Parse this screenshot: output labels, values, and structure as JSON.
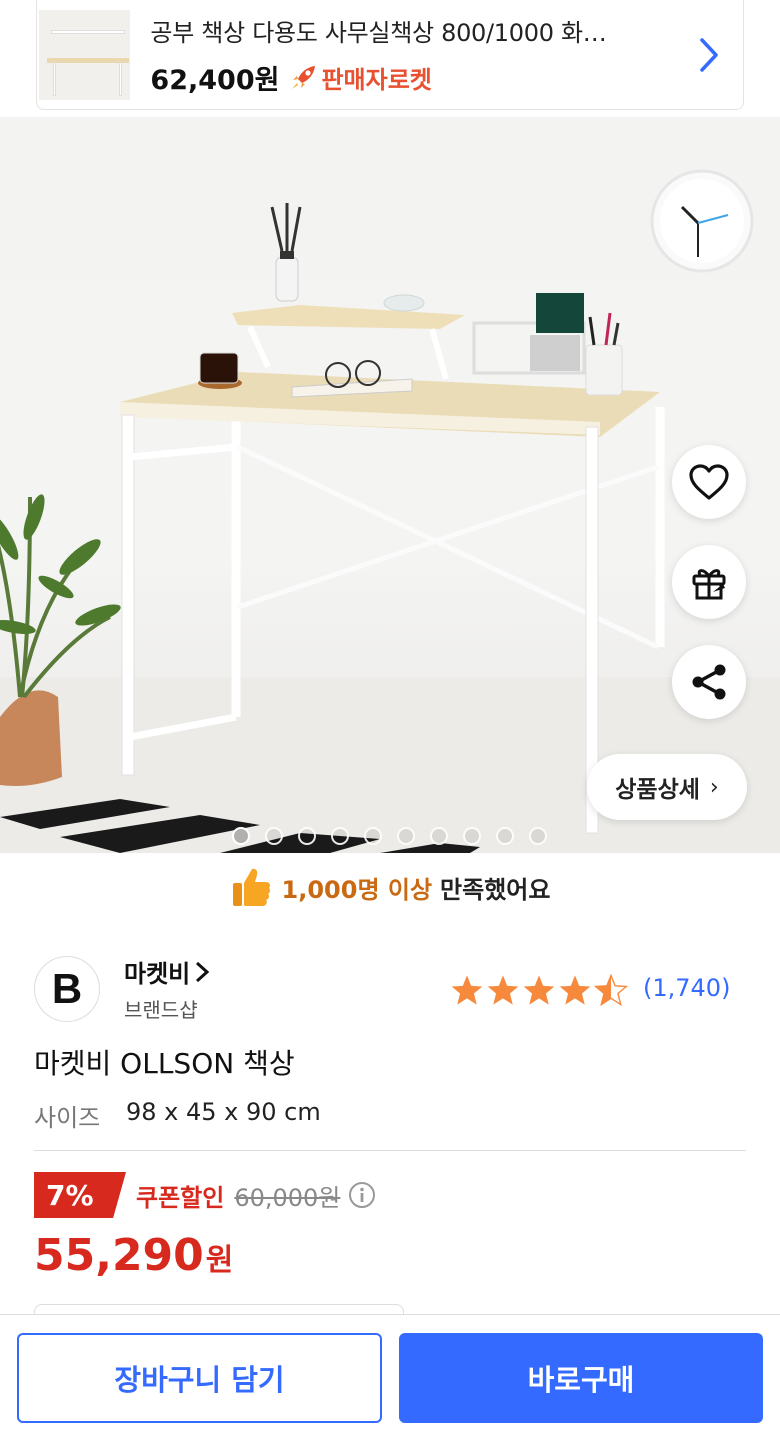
{
  "top_product": {
    "title": "공부 책상 다용도 사무실책상 800/1000 화…",
    "price": "62,400원",
    "badge": "판매자로켓",
    "badge_icon": "rocket-icon",
    "chevron_icon": "chevron-right-icon"
  },
  "gallery": {
    "image_count": 10,
    "active_index": 0,
    "actions": [
      {
        "name": "heart-icon"
      },
      {
        "name": "gift-icon"
      },
      {
        "name": "share-icon"
      }
    ],
    "detail_button": "상품상세"
  },
  "satisfaction": {
    "icon": "thumbs-up-icon",
    "highlight": "1,000명 이상",
    "text": "만족했어요"
  },
  "seller": {
    "logo_letter": "B",
    "name": "마켓비",
    "type": "브랜드샵"
  },
  "rating": {
    "stars": 4.5,
    "count": "(1,740)"
  },
  "product": {
    "name": "마켓비 OLLSON 책상",
    "size_label": "사이즈",
    "size_value": "98 x 45 x 90 cm"
  },
  "pricing": {
    "discount": "7%",
    "coupon_label": "쿠폰할인",
    "original_price": "60,000원",
    "final_price": "55,290",
    "currency": "원"
  },
  "actions": {
    "cart": "장바구니 담기",
    "buy": "바로구매"
  },
  "colors": {
    "accent_blue": "#346aff",
    "discount_red": "#d8291e",
    "star_orange": "#f7893c",
    "satisfaction_orange": "#c96a12"
  }
}
